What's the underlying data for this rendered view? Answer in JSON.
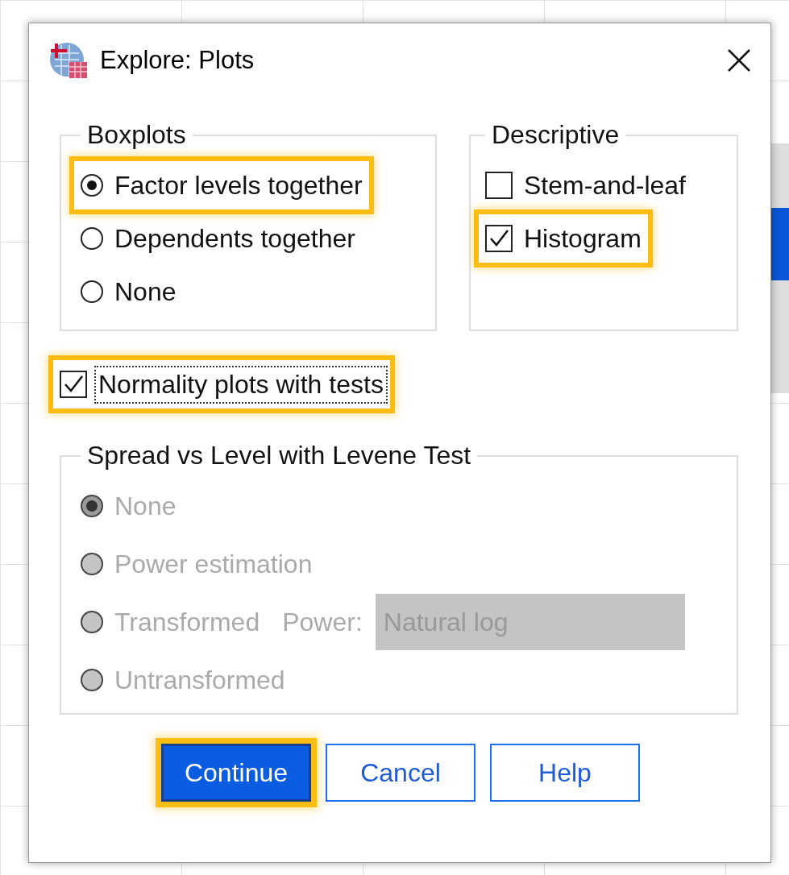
{
  "window": {
    "title": "Explore: Plots"
  },
  "boxplots": {
    "title": "Boxplots",
    "options": [
      {
        "label": "Factor levels together",
        "selected": true,
        "highlighted": true
      },
      {
        "label": "Dependents together",
        "selected": false,
        "highlighted": false
      },
      {
        "label": "None",
        "selected": false,
        "highlighted": false
      }
    ]
  },
  "descriptive": {
    "title": "Descriptive",
    "options": [
      {
        "label": "Stem-and-leaf",
        "checked": false,
        "highlighted": false
      },
      {
        "label": "Histogram",
        "checked": true,
        "highlighted": true
      }
    ]
  },
  "normality": {
    "label": "Normality plots with tests",
    "checked": true,
    "highlighted": true,
    "focused": true
  },
  "spread": {
    "title": "Spread vs Level with Levene Test",
    "disabled": true,
    "options": [
      {
        "label": "None",
        "selected": true
      },
      {
        "label": "Power estimation",
        "selected": false
      },
      {
        "label": "Transformed",
        "selected": false,
        "power": {
          "label": "Power:",
          "value": "Natural log"
        }
      },
      {
        "label": "Untransformed",
        "selected": false
      }
    ]
  },
  "buttons": [
    {
      "label": "Continue",
      "default": true,
      "highlighted": true
    },
    {
      "label": "Cancel",
      "default": false,
      "highlighted": false
    },
    {
      "label": "Help",
      "default": false,
      "highlighted": false
    }
  ]
}
